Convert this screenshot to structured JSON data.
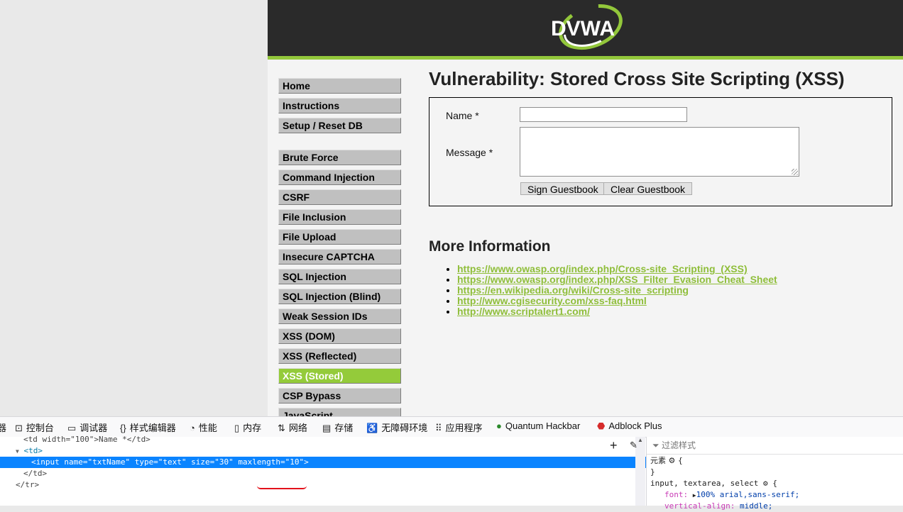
{
  "logo": {
    "text": "DVWA"
  },
  "menu": {
    "group1": [
      "Home",
      "Instructions",
      "Setup / Reset DB"
    ],
    "group2": [
      "Brute Force",
      "Command Injection",
      "CSRF",
      "File Inclusion",
      "File Upload",
      "Insecure CAPTCHA",
      "SQL Injection",
      "SQL Injection (Blind)",
      "Weak Session IDs",
      "XSS (DOM)",
      "XSS (Reflected)",
      "XSS (Stored)",
      "CSP Bypass",
      "JavaScript"
    ],
    "selected": "XSS (Stored)"
  },
  "main": {
    "title": "Vulnerability: Stored Cross Site Scripting (XSS)",
    "form": {
      "name_label": "Name *",
      "message_label": "Message *",
      "name_value": "",
      "message_value": "",
      "sign_button": "Sign Guestbook",
      "clear_button": "Clear Guestbook"
    },
    "more_info_title": "More Information",
    "links": [
      "https://www.owasp.org/index.php/Cross-site_Scripting_(XSS)",
      "https://www.owasp.org/index.php/XSS_Filter_Evasion_Cheat_Sheet",
      "https://en.wikipedia.org/wiki/Cross-site_scripting",
      "http://www.cgisecurity.com/xss-faq.html",
      "http://www.scriptalert1.com/"
    ]
  },
  "devtools": {
    "tabs": [
      {
        "label": "器",
        "icon": "inspector-icon"
      },
      {
        "label": "控制台",
        "icon": "console-icon"
      },
      {
        "label": "调试器",
        "icon": "debugger-icon"
      },
      {
        "label": "样式编辑器",
        "icon": "style-editor-icon"
      },
      {
        "label": "性能",
        "icon": "performance-icon"
      },
      {
        "label": "内存",
        "icon": "memory-icon"
      },
      {
        "label": "网络",
        "icon": "network-icon"
      },
      {
        "label": "存储",
        "icon": "storage-icon"
      },
      {
        "label": "无障碍环境",
        "icon": "accessibility-icon"
      },
      {
        "label": "应用程序",
        "icon": "application-icon"
      },
      {
        "label": "Quantum Hackbar",
        "icon": "hackbar-icon"
      },
      {
        "label": "Adblock Plus",
        "icon": "adblock-icon"
      }
    ],
    "html_lines": [
      "<td width=\"100\">Name *</td>",
      "<td>",
      "<input name=\"txtName\" type=\"text\" size=\"30\" maxlength=\"10\">",
      "</td>",
      "</tr>"
    ],
    "filter_placeholder": "过滤样式",
    "rules": {
      "element_selector": "元素",
      "element_open": "{",
      "element_close": "}",
      "selector2": "input, textarea, select",
      "prop1": "font:",
      "val1": "100% arial,sans-serif;",
      "prop2": "vertical-align:",
      "val2": "middle;"
    }
  }
}
